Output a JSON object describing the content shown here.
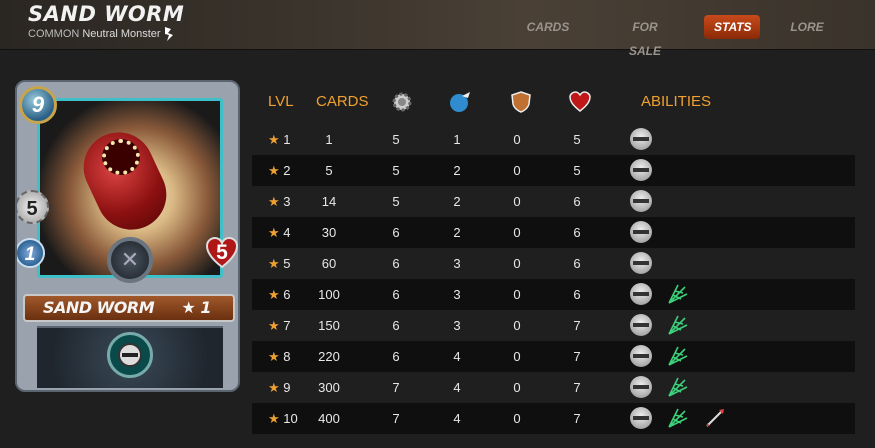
{
  "header": {
    "title": "SAND WORM",
    "rarity": "COMMON",
    "type": "Neutral Monster",
    "tabs": [
      "CARDS",
      "FOR SALE",
      "STATS",
      "LORE"
    ],
    "active_tab": "STATS"
  },
  "card": {
    "mana": "9",
    "melee": "5",
    "speed": "1",
    "health": "5",
    "name": "SAND WORM",
    "level": "★ 1"
  },
  "table": {
    "headers": {
      "lvl": "LVL",
      "cards": "CARDS",
      "abilities": "ABILITIES"
    },
    "stat_icons": [
      "melee-attack-icon",
      "speed-icon",
      "armor-icon",
      "health-icon"
    ],
    "rows": [
      {
        "lvl": "1",
        "cards": "1",
        "melee": "5",
        "speed": "1",
        "armor": "0",
        "health": "5",
        "abilities": [
          "sneak"
        ]
      },
      {
        "lvl": "2",
        "cards": "5",
        "melee": "5",
        "speed": "2",
        "armor": "0",
        "health": "5",
        "abilities": [
          "sneak"
        ]
      },
      {
        "lvl": "3",
        "cards": "14",
        "melee": "5",
        "speed": "2",
        "armor": "0",
        "health": "6",
        "abilities": [
          "sneak"
        ]
      },
      {
        "lvl": "4",
        "cards": "30",
        "melee": "6",
        "speed": "2",
        "armor": "0",
        "health": "6",
        "abilities": [
          "sneak"
        ]
      },
      {
        "lvl": "5",
        "cards": "60",
        "melee": "6",
        "speed": "3",
        "armor": "0",
        "health": "6",
        "abilities": [
          "sneak"
        ]
      },
      {
        "lvl": "6",
        "cards": "100",
        "melee": "6",
        "speed": "3",
        "armor": "0",
        "health": "6",
        "abilities": [
          "sneak",
          "poison"
        ]
      },
      {
        "lvl": "7",
        "cards": "150",
        "melee": "6",
        "speed": "3",
        "armor": "0",
        "health": "7",
        "abilities": [
          "sneak",
          "poison"
        ]
      },
      {
        "lvl": "8",
        "cards": "220",
        "melee": "6",
        "speed": "4",
        "armor": "0",
        "health": "7",
        "abilities": [
          "sneak",
          "poison"
        ]
      },
      {
        "lvl": "9",
        "cards": "300",
        "melee": "7",
        "speed": "4",
        "armor": "0",
        "health": "7",
        "abilities": [
          "sneak",
          "poison"
        ]
      },
      {
        "lvl": "10",
        "cards": "400",
        "melee": "7",
        "speed": "4",
        "armor": "0",
        "health": "7",
        "abilities": [
          "sneak",
          "poison",
          "snipe"
        ]
      }
    ]
  },
  "colors": {
    "accent": "#f0a030",
    "active_tab": "#c84a1a"
  }
}
